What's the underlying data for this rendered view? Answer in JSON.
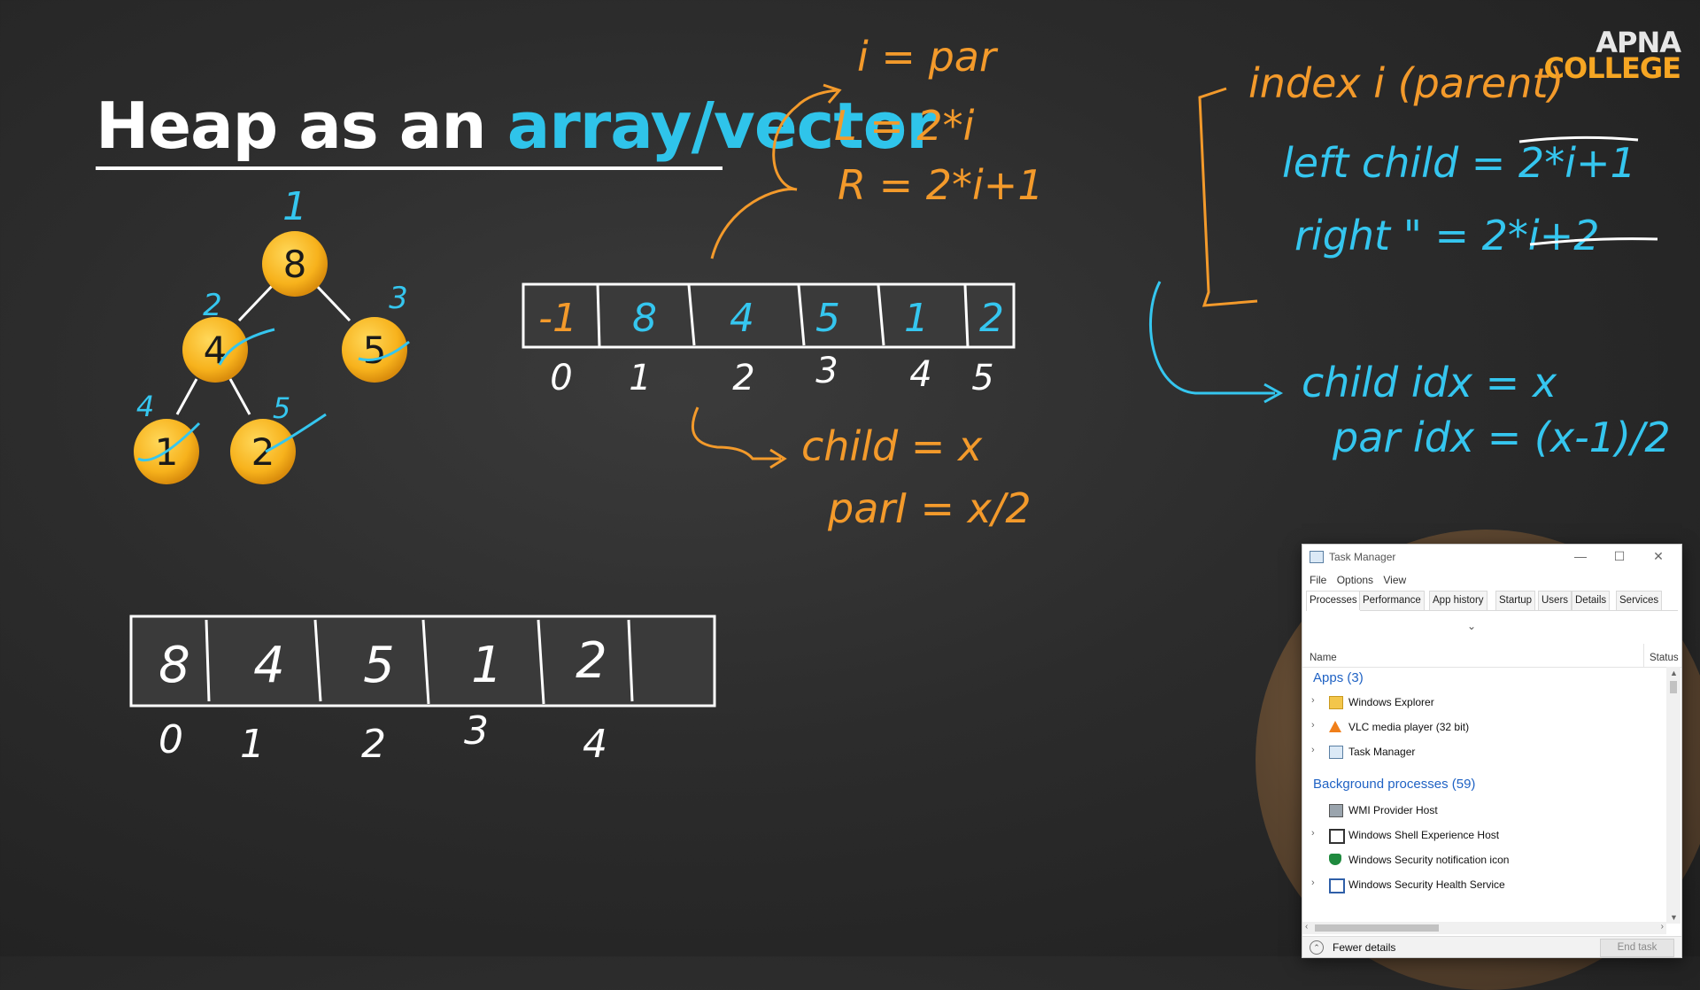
{
  "title": {
    "lead": "Heap as an ",
    "accent": "array/vector"
  },
  "brand": {
    "line1": "APNA",
    "line2": "COLLEGE"
  },
  "tree": {
    "nodes": [
      {
        "value": "8",
        "index": "1"
      },
      {
        "value": "4",
        "index": "2"
      },
      {
        "value": "5",
        "index": "3"
      },
      {
        "value": "1",
        "index": "4"
      },
      {
        "value": "2",
        "index": "5"
      }
    ]
  },
  "array_top": {
    "cells": [
      "-1",
      "8",
      "4",
      "5",
      "1",
      "2"
    ],
    "indices": [
      "0",
      "1",
      "2",
      "3",
      "4",
      "5"
    ]
  },
  "array_bottom": {
    "cells": [
      "8",
      "4",
      "5",
      "1",
      "2"
    ],
    "indices": [
      "0",
      "1",
      "2",
      "3",
      "4"
    ]
  },
  "notes": {
    "orange_formula": {
      "l1": "i = par",
      "l2": "L = 2*i",
      "l3": "R = 2*i+1"
    },
    "orange_child": {
      "l1": "child = x",
      "l2": "parI = x/2"
    },
    "orange_right": "index i (parent)",
    "blue_right": {
      "l1": "left child = 2*i+1",
      "l2": "right \" = 2*i+2"
    },
    "blue_child": {
      "l1": "child idx = x",
      "l2": "par idx = (x-1)/2"
    }
  },
  "colors": {
    "orange": "#f39a2b",
    "blue": "#35c6ef",
    "node": "#f7b21c",
    "title_accent": "#2fc4ea"
  },
  "task_manager": {
    "title": "Task Manager",
    "icon": "task-manager-icon",
    "window_buttons": [
      "—",
      "☐",
      "✕"
    ],
    "menu": [
      "File",
      "Options",
      "View"
    ],
    "tabs": [
      "Processes",
      "Performance",
      "App history",
      "Startup",
      "Users",
      "Details",
      "Services"
    ],
    "active_tab": "Processes",
    "columns": {
      "name": "Name",
      "status": "Status"
    },
    "apps_header": "Apps (3)",
    "apps": [
      {
        "label": "Windows Explorer",
        "icon": "folder-icon"
      },
      {
        "label": "VLC media player (32 bit)",
        "icon": "vlc-cone-icon"
      },
      {
        "label": "Task Manager",
        "icon": "task-manager-icon"
      }
    ],
    "bg_header": "Background processes (59)",
    "background": [
      {
        "label": "WMI Provider Host",
        "icon": "gear-window-icon",
        "expand": false
      },
      {
        "label": "Windows Shell Experience Host",
        "icon": "window-icon",
        "expand": true
      },
      {
        "label": "Windows Security notification icon",
        "icon": "shield-icon",
        "expand": false
      },
      {
        "label": "Windows Security Health Service",
        "icon": "window-icon",
        "expand": true
      }
    ],
    "footer": {
      "fewer_details": "Fewer details",
      "end_task": "End task"
    }
  }
}
